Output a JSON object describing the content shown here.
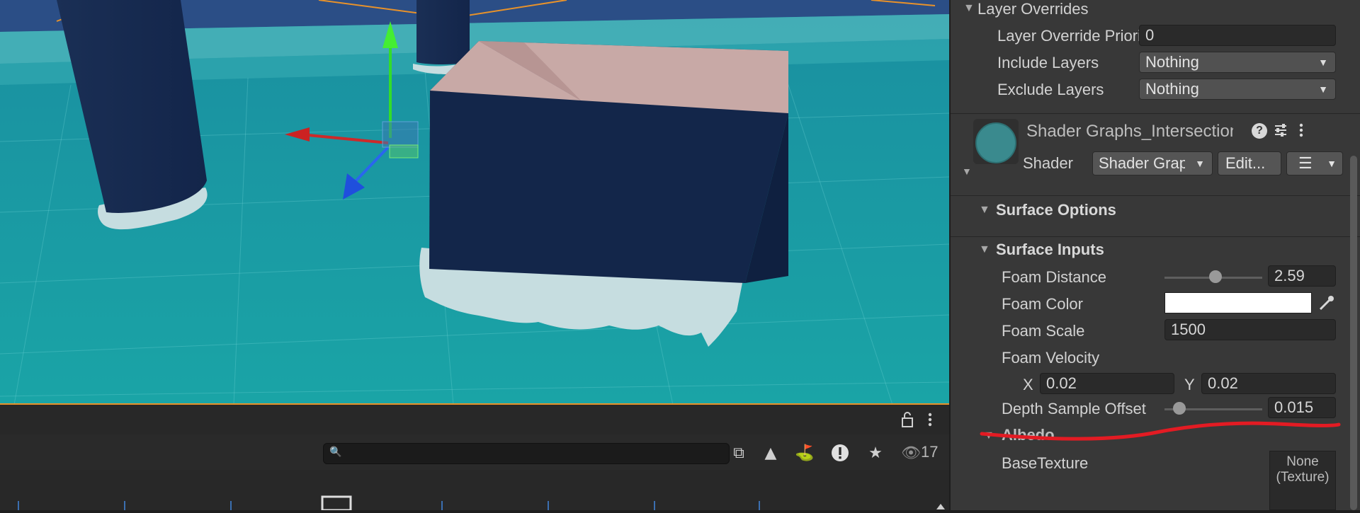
{
  "colors": {
    "accent_orange": "#e8922a",
    "water": "#16a2a6",
    "box_navy": "#13264a",
    "foam": "#c6dde0",
    "annotation_red": "#e31b23",
    "panel_bg": "#383838"
  },
  "layer_overrides": {
    "header": "Layer Overrides",
    "priority_label": "Layer Override Priority",
    "priority_value": "0",
    "include_label": "Include Layers",
    "include_value": "Nothing",
    "exclude_label": "Exclude Layers",
    "exclude_value": "Nothing"
  },
  "material": {
    "title": "Shader Graphs_IntersectionFoam",
    "shader_label": "Shader",
    "shader_value": "Shader Graphs",
    "edit_button": "Edit...",
    "icons": [
      "help-icon",
      "preset-icon",
      "kebab-menu-icon",
      "list-icon"
    ]
  },
  "surface_options": {
    "header": "Surface Options"
  },
  "surface_inputs": {
    "header": "Surface Inputs",
    "foam_distance_label": "Foam Distance",
    "foam_distance_value": "2.59",
    "foam_distance_slider": 0.52,
    "foam_color_label": "Foam Color",
    "foam_color_value": "#ffffff",
    "foam_scale_label": "Foam Scale",
    "foam_scale_value": "1500",
    "foam_velocity_label": "Foam Velocity",
    "x_label": "X",
    "x_value": "0.02",
    "y_label": "Y",
    "y_value": "0.02",
    "depth_offset_label": "Depth Sample Offset",
    "depth_offset_value": "0.015",
    "depth_offset_slider": 0.15,
    "albedo_header": "Albedo",
    "base_texture_label": "BaseTexture",
    "base_texture_value_line1": "None",
    "base_texture_value_line2": "(Texture)"
  },
  "bottom_panel": {
    "visible_count": "17",
    "search_placeholder": "",
    "icons": [
      "lock-icon",
      "kebab-menu-icon",
      "search-icon",
      "scene-link-icon",
      "shapes-icon",
      "tag-icon",
      "warning-icon",
      "star-icon",
      "eye-icon"
    ]
  }
}
